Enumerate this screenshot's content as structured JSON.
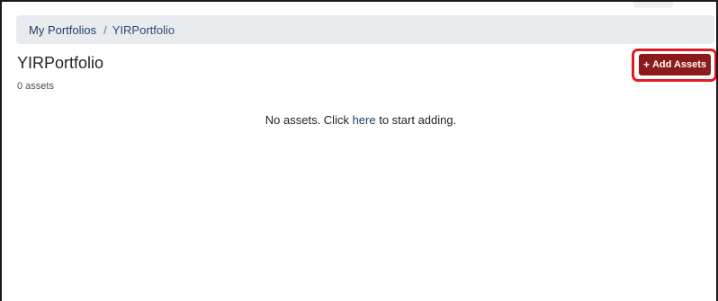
{
  "breadcrumb": {
    "items": [
      {
        "label": "My Portfolios"
      },
      {
        "label": "YIRPortfolio"
      }
    ],
    "separator": "/"
  },
  "page": {
    "title": "YIRPortfolio",
    "asset_count": "0 assets"
  },
  "toolbar": {
    "add_assets_icon": "+",
    "add_assets_label": "Add Assets",
    "add_assets_color": "#8b1a1a",
    "highlight_color": "#e11b22"
  },
  "empty_state": {
    "prefix": "No assets. Click ",
    "link": "here",
    "suffix": " to start adding."
  }
}
